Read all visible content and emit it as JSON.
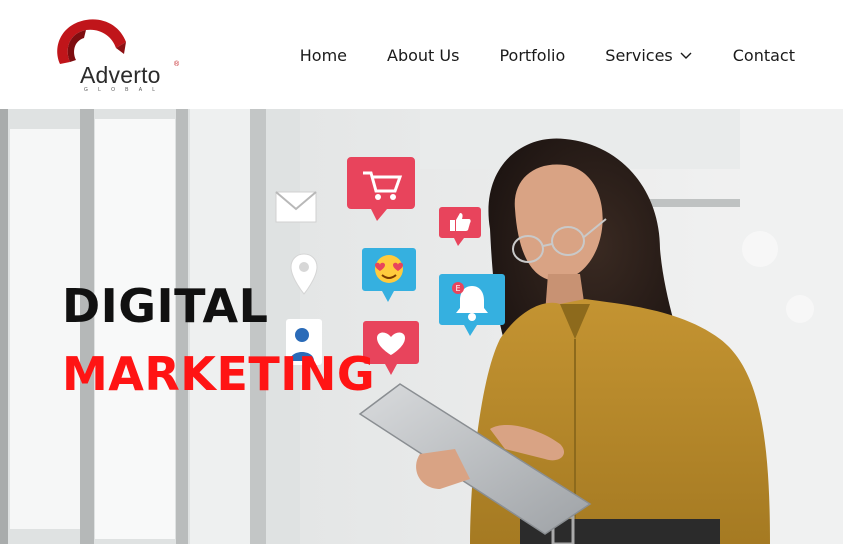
{
  "brand": {
    "name": "Adverto",
    "tagline": "GLOBAL",
    "registered_mark": "®"
  },
  "nav": {
    "items": [
      {
        "label": "Home"
      },
      {
        "label": "About Us"
      },
      {
        "label": "Portfolio"
      },
      {
        "label": "Services"
      },
      {
        "label": "Contact"
      }
    ]
  },
  "hero": {
    "title_line1": "DIGITAL",
    "title_line2": "MARKETING",
    "floating_icons": [
      "envelope-icon",
      "shopping-cart-icon",
      "like-icon",
      "location-pin-icon",
      "heart-eyes-emoji-icon",
      "notification-bell-icon",
      "user-profile-icon",
      "heart-icon"
    ],
    "notification_badge": "E"
  },
  "colors": {
    "accent_red": "#ff1414",
    "brand_red": "#c0151a",
    "icon_pink": "#e8445c",
    "icon_blue": "#35b0e0",
    "shirt_mustard": "#b78a2a"
  }
}
